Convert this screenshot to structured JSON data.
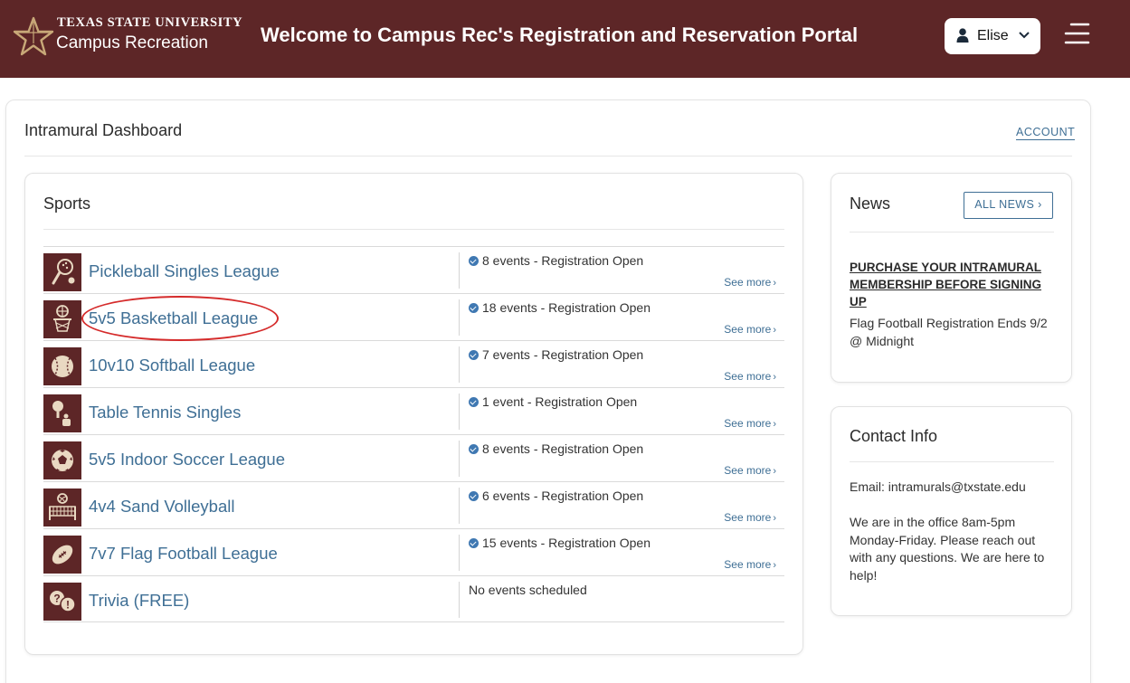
{
  "header": {
    "university": "TEXAS STATE UNIVERSITY",
    "department": "Campus Recreation",
    "welcome": "Welcome to Campus Rec's Registration and Reservation Portal",
    "user_name": "Elise",
    "background_color": "#5d2627"
  },
  "dashboard": {
    "title": "Intramural Dashboard",
    "account_link": "ACCOUNT"
  },
  "sports": {
    "title": "Sports",
    "see_more_label": "See more",
    "items": [
      {
        "name": "Pickleball Singles League",
        "icon": "pickleball-icon",
        "status": "8 events - Registration Open",
        "has_events": true
      },
      {
        "name": "5v5 Basketball League",
        "icon": "basketball-icon",
        "status": "18 events - Registration Open",
        "has_events": true,
        "highlighted": true
      },
      {
        "name": "10v10 Softball League",
        "icon": "softball-icon",
        "status": "7 events - Registration Open",
        "has_events": true
      },
      {
        "name": "Table Tennis Singles",
        "icon": "table-tennis-icon",
        "status": "1 event - Registration Open",
        "has_events": true
      },
      {
        "name": "5v5 Indoor Soccer League",
        "icon": "soccer-ball-icon",
        "status": "8 events - Registration Open",
        "has_events": true
      },
      {
        "name": "4v4 Sand Volleyball",
        "icon": "volleyball-net-icon",
        "status": "6 events - Registration Open",
        "has_events": true
      },
      {
        "name": "7v7 Flag Football League",
        "icon": "football-icon",
        "status": "15 events - Registration Open",
        "has_events": true
      },
      {
        "name": "Trivia (FREE)",
        "icon": "trivia-icon",
        "status": "No events scheduled",
        "has_events": false
      }
    ]
  },
  "news": {
    "title": "News",
    "all_news_label": "ALL NEWS",
    "headline": "PURCHASE YOUR INTRAMURAL MEMBERSHIP BEFORE SIGNING UP",
    "body": "Flag Football Registration Ends 9/2 @ Midnight"
  },
  "contact": {
    "title": "Contact Info",
    "email": "Email: intramurals@txstate.edu",
    "hours": "We are in the office 8am-5pm Monday-Friday. Please reach out with any questions. We are here to help!"
  },
  "colors": {
    "maroon": "#5d2627",
    "link_blue": "#3f6f95",
    "check_blue": "#3f78b2",
    "annotation_red": "#d52b2b"
  }
}
